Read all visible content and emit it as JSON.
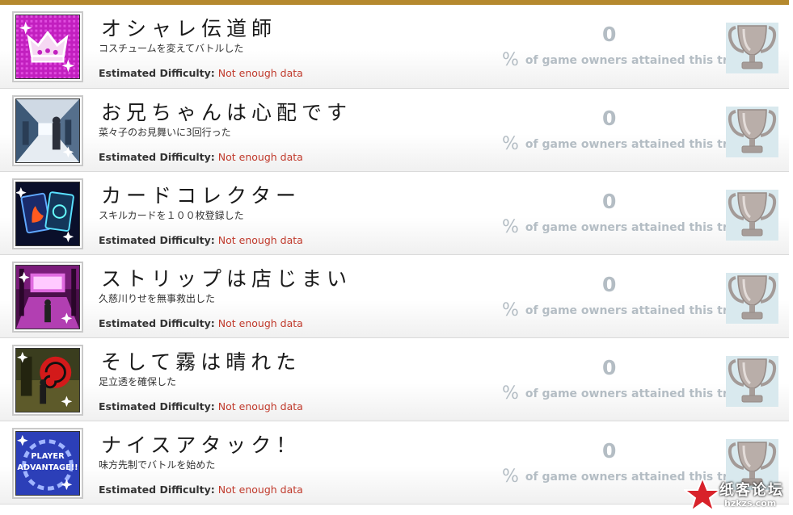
{
  "trophies": [
    {
      "title": "オシャレ伝道師",
      "description": "コスチュームを変えてバトルした",
      "difficulty_label": "Estimated Difficulty:",
      "difficulty_value": "Not enough data",
      "percent": "0",
      "percent_symbol": "%",
      "attained_text": "of game owners attained this trophy",
      "icon": "crown-icon"
    },
    {
      "title": "お兄ちゃんは心配です",
      "description": "菜々子のお見舞いに3回行った",
      "difficulty_label": "Estimated Difficulty:",
      "difficulty_value": "Not enough data",
      "percent": "0",
      "percent_symbol": "%",
      "attained_text": "of game owners attained this trophy",
      "icon": "hospital-corridor-icon"
    },
    {
      "title": "カードコレクター",
      "description": "スキルカードを１００枚登録した",
      "difficulty_label": "Estimated Difficulty:",
      "difficulty_value": "Not enough data",
      "percent": "0",
      "percent_symbol": "%",
      "attained_text": "of game owners attained this trophy",
      "icon": "skill-cards-icon"
    },
    {
      "title": "ストリップは店じまい",
      "description": "久慈川りせを無事救出した",
      "difficulty_label": "Estimated Difficulty:",
      "difficulty_value": "Not enough data",
      "percent": "0",
      "percent_symbol": "%",
      "attained_text": "of game owners attained this trophy",
      "icon": "stage-icon"
    },
    {
      "title": "そして霧は晴れた",
      "description": "足立透を確保した",
      "difficulty_label": "Estimated Difficulty:",
      "difficulty_value": "Not enough data",
      "percent": "0",
      "percent_symbol": "%",
      "attained_text": "of game owners attained this trophy",
      "icon": "red-spiral-icon"
    },
    {
      "title": "ナイスアタック！",
      "description": "味方先制でバトルを始めた",
      "difficulty_label": "Estimated Difficulty:",
      "difficulty_value": "Not enough data",
      "percent": "0",
      "percent_symbol": "%",
      "attained_text": "of game owners attained this trophy",
      "icon": "player-advantage-icon",
      "icon_text": [
        "PLAYER",
        "ADVANTAGE!!"
      ]
    }
  ],
  "trophy_icon": "silver-trophy-icon",
  "watermark": {
    "text": "纸客论坛",
    "url": "hzkzs.com"
  },
  "colors": {
    "accent_bar": "#b5892e",
    "difficulty_value": "#c0392b",
    "percent": "#b4bdc4",
    "trophy_bg": "#d9e9ee"
  }
}
